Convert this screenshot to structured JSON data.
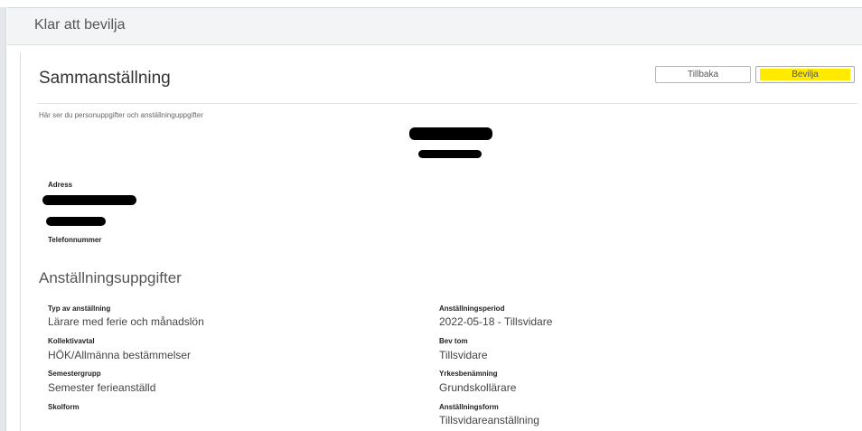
{
  "header": {
    "title": "Klar att bevilja"
  },
  "summary": {
    "title": "Sammanställning",
    "subtitle": "Här ser du personuppgifter och anställninguppgifter",
    "back_label": "Tillbaka",
    "approve_label": "Bevilja",
    "address_label": "Adress",
    "phone_label": "Telefonnummer"
  },
  "employment": {
    "title": "Anställningsuppgifter",
    "left": [
      {
        "label": "Typ av anställning",
        "value": "Lärare med ferie och månadslön"
      },
      {
        "label": "Kollektivavtal",
        "value": "HÖK/Allmänna bestämmelser"
      },
      {
        "label": "Semestergrupp",
        "value": "Semester ferieanställd"
      },
      {
        "label": "Skolform",
        "value": ""
      }
    ],
    "right": [
      {
        "label": "Anställningsperiod",
        "value": "2022-05-18 - Tillsvidare"
      },
      {
        "label": "Bev tom",
        "value": "Tillsvidare"
      },
      {
        "label": "Yrkesbenämning",
        "value": "Grundskollärare"
      },
      {
        "label": "Anställningsform",
        "value": "Tillsvidareanställning"
      }
    ]
  },
  "colors": {
    "accent": "#ffea00",
    "background": "#f3f4f6"
  }
}
